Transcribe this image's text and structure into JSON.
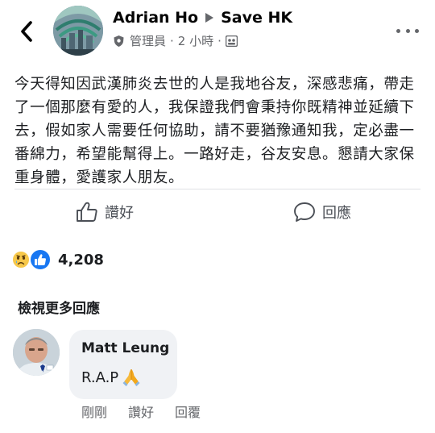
{
  "header": {
    "page_name": "Adrian Ho",
    "group_name": "Save HK",
    "role": "管理員",
    "time": "2 小時",
    "back_icon": "chevron-left-icon",
    "more_icon": "more-horizontal-icon"
  },
  "post": {
    "text": "今天得知因武漢肺炎去世的人是我地谷友，深感悲痛，帶走了一個那麼有愛的人，我保證我們會秉持你既精神並延續下去，假如家人需要任何協助，請不要猶豫通知我，定必盡一番綿力，希望能幫得上。一路好走，谷友安息。懇請大家保重身體，愛護家人朋友。"
  },
  "actions": {
    "like_label": "讚好",
    "comment_label": "回應"
  },
  "reactions": {
    "count": "4,208"
  },
  "comments": {
    "view_more_label": "檢視更多回應",
    "items": [
      {
        "author": "Matt Leung",
        "text": "R.A.P",
        "time": "剛剛",
        "like_label": "讚好",
        "reply_label": "回覆"
      }
    ]
  },
  "colors": {
    "like_blue": "#1877f2",
    "secondary_text": "#65676b",
    "bubble_bg": "#f0f2f5"
  }
}
